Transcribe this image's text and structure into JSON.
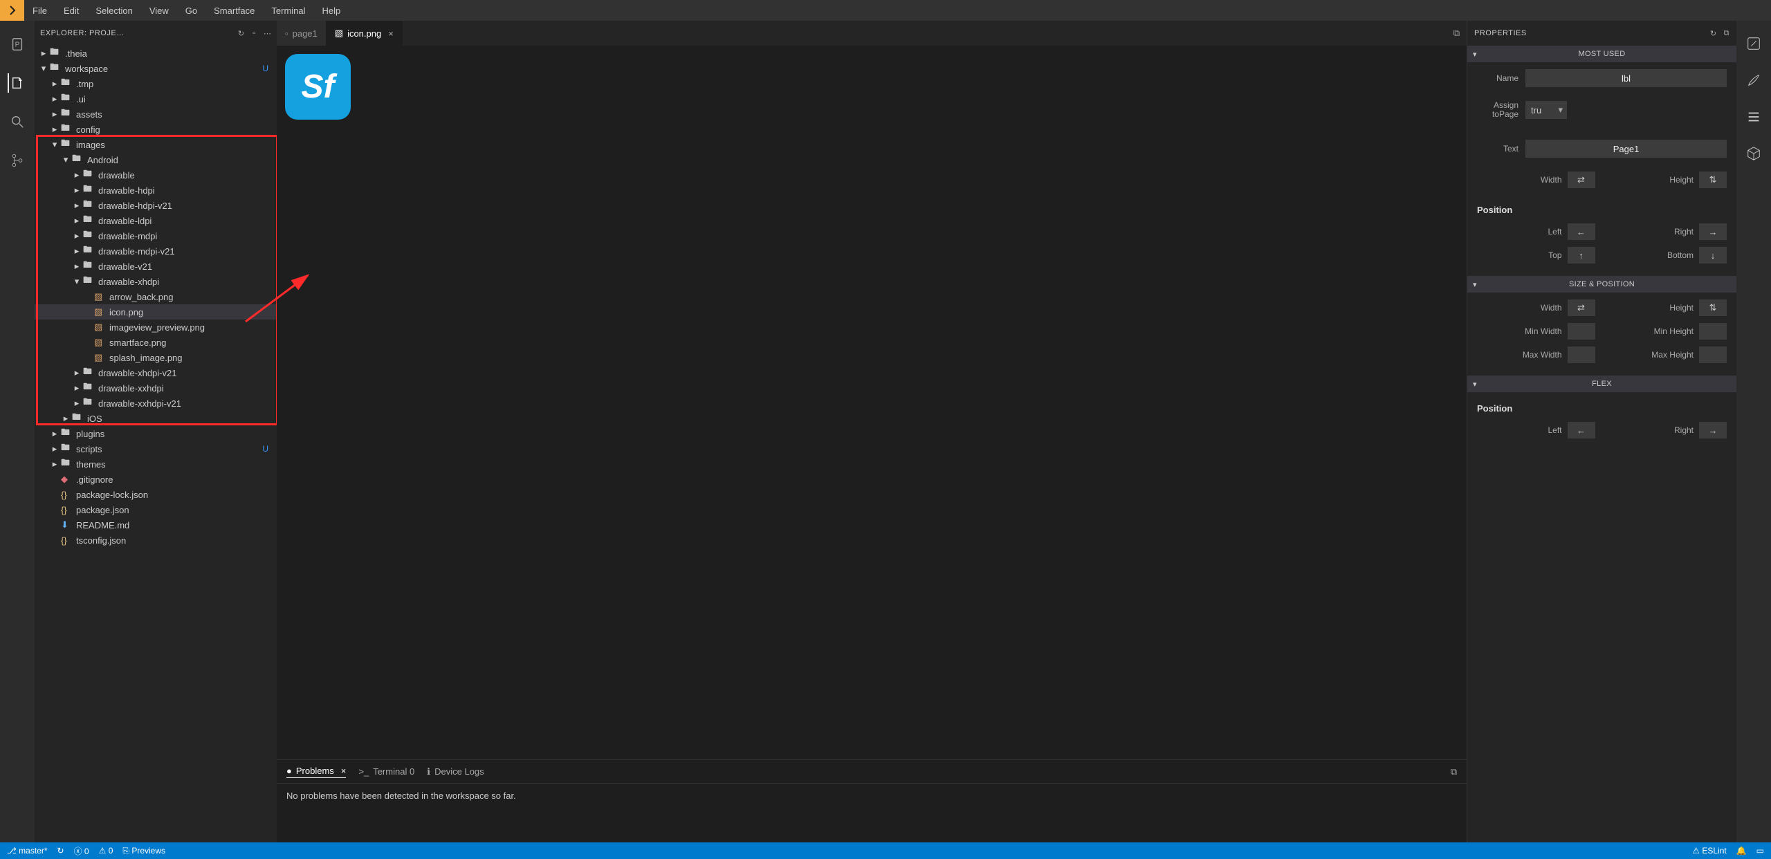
{
  "menubar": [
    "File",
    "Edit",
    "Selection",
    "View",
    "Go",
    "Smartface",
    "Terminal",
    "Help"
  ],
  "explorer": {
    "title": "EXPLORER: PROJE…",
    "items": [
      {
        "label": ".theia",
        "type": "folder",
        "indent": 0,
        "open": false
      },
      {
        "label": "workspace",
        "type": "folder",
        "indent": 0,
        "open": true,
        "badge": "U"
      },
      {
        "label": ".tmp",
        "type": "folder",
        "indent": 1,
        "open": false
      },
      {
        "label": ".ui",
        "type": "folder",
        "indent": 1,
        "open": false
      },
      {
        "label": "assets",
        "type": "folder",
        "indent": 1,
        "open": false
      },
      {
        "label": "config",
        "type": "folder",
        "indent": 1,
        "open": false
      },
      {
        "label": "images",
        "type": "folder",
        "indent": 1,
        "open": true
      },
      {
        "label": "Android",
        "type": "folder",
        "indent": 2,
        "open": true
      },
      {
        "label": "drawable",
        "type": "folder",
        "indent": 3,
        "open": false
      },
      {
        "label": "drawable-hdpi",
        "type": "folder",
        "indent": 3,
        "open": false
      },
      {
        "label": "drawable-hdpi-v21",
        "type": "folder",
        "indent": 3,
        "open": false
      },
      {
        "label": "drawable-ldpi",
        "type": "folder",
        "indent": 3,
        "open": false
      },
      {
        "label": "drawable-mdpi",
        "type": "folder",
        "indent": 3,
        "open": false
      },
      {
        "label": "drawable-mdpi-v21",
        "type": "folder",
        "indent": 3,
        "open": false
      },
      {
        "label": "drawable-v21",
        "type": "folder",
        "indent": 3,
        "open": false
      },
      {
        "label": "drawable-xhdpi",
        "type": "folder",
        "indent": 3,
        "open": true
      },
      {
        "label": "arrow_back.png",
        "type": "image",
        "indent": 4
      },
      {
        "label": "icon.png",
        "type": "image",
        "indent": 4,
        "selected": true
      },
      {
        "label": "imageview_preview.png",
        "type": "image",
        "indent": 4
      },
      {
        "label": "smartface.png",
        "type": "image",
        "indent": 4
      },
      {
        "label": "splash_image.png",
        "type": "image",
        "indent": 4
      },
      {
        "label": "drawable-xhdpi-v21",
        "type": "folder",
        "indent": 3,
        "open": false
      },
      {
        "label": "drawable-xxhdpi",
        "type": "folder",
        "indent": 3,
        "open": false
      },
      {
        "label": "drawable-xxhdpi-v21",
        "type": "folder",
        "indent": 3,
        "open": false
      },
      {
        "label": "iOS",
        "type": "folder",
        "indent": 2,
        "open": false
      },
      {
        "label": "plugins",
        "type": "folder",
        "indent": 1,
        "open": false
      },
      {
        "label": "scripts",
        "type": "folder",
        "indent": 1,
        "open": false,
        "badge": "U"
      },
      {
        "label": "themes",
        "type": "folder",
        "indent": 1,
        "open": false
      },
      {
        "label": ".gitignore",
        "type": "gitfile",
        "indent": 1
      },
      {
        "label": "package-lock.json",
        "type": "jsonfile",
        "indent": 1
      },
      {
        "label": "package.json",
        "type": "jsonfile",
        "indent": 1
      },
      {
        "label": "README.md",
        "type": "mdfile",
        "indent": 1
      },
      {
        "label": "tsconfig.json",
        "type": "jsonfile",
        "indent": 1
      }
    ]
  },
  "tabs": [
    {
      "label": "page1",
      "icon": "page",
      "active": false
    },
    {
      "label": "icon.png",
      "icon": "image",
      "active": true,
      "close": true
    }
  ],
  "preview_text": "Sf",
  "bottom_tabs": [
    {
      "label": "Problems",
      "icon": "●",
      "active": true,
      "close": true
    },
    {
      "label": "Terminal 0",
      "icon": ">_",
      "active": false
    },
    {
      "label": "Device Logs",
      "icon": "ℹ",
      "active": false
    }
  ],
  "bottom_message": "No problems have been detected in the workspace so far.",
  "properties": {
    "title": "PROPERTIES",
    "sections": {
      "most_used": {
        "title": "MOST USED",
        "name_label": "Name",
        "name_value": "lbl",
        "assign_label": "Assign toPage",
        "assign_value": "tru",
        "text_label": "Text",
        "text_value": "Page1",
        "width_label": "Width",
        "height_label": "Height",
        "pos_title": "Position",
        "left_label": "Left",
        "right_label": "Right",
        "top_label": "Top",
        "bottom_label": "Bottom"
      },
      "size_position": {
        "title": "SIZE & POSITION",
        "width_label": "Width",
        "height_label": "Height",
        "minw_label": "Min Width",
        "minh_label": "Min Height",
        "maxw_label": "Max Width",
        "maxh_label": "Max Height"
      },
      "flex": {
        "title": "FLEX",
        "pos_title": "Position",
        "left_label": "Left",
        "right_label": "Right"
      }
    }
  },
  "status": {
    "branch": "master*",
    "errors": "0",
    "warnings": "0",
    "previews": "Previews",
    "eslint": "ESLint"
  }
}
